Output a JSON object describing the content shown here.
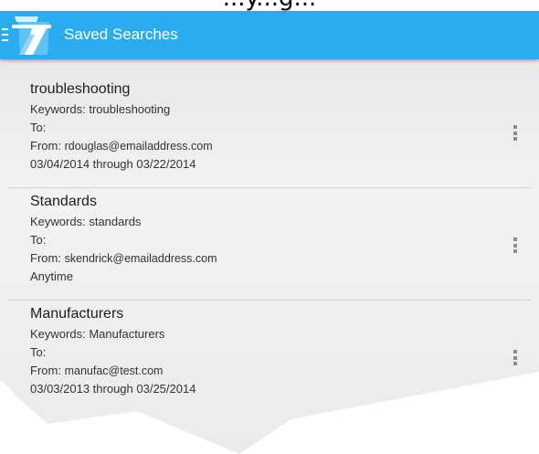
{
  "caption": "...y...g...",
  "app_bar": {
    "title": "Saved Searches",
    "menu_icon": "hamburger-menu-icon",
    "logo_icon": "app-logo-icon",
    "color": "#2bacf1"
  },
  "saved_searches": [
    {
      "name": "troubleshooting",
      "keywords_label": "Keywords:",
      "keywords": "troubleshooting",
      "to_label": "To:",
      "to": "",
      "from_label": "From:",
      "from": "rdouglas@emailaddress.com",
      "date_range": "03/04/2014 through 03/22/2014"
    },
    {
      "name": "Standards",
      "keywords_label": "Keywords:",
      "keywords": "standards",
      "to_label": "To:",
      "to": "",
      "from_label": "From:",
      "from": "skendrick@emailaddress.com",
      "date_range": "Anytime"
    },
    {
      "name": "Manufacturers",
      "keywords_label": "Keywords:",
      "keywords": "Manufacturers",
      "to_label": "To:",
      "to": "",
      "from_label": "From:",
      "from": "manufac@test.com",
      "date_range": "03/03/2013 through 03/25/2014"
    }
  ],
  "overflow_icon": "vertical-ellipsis-icon"
}
